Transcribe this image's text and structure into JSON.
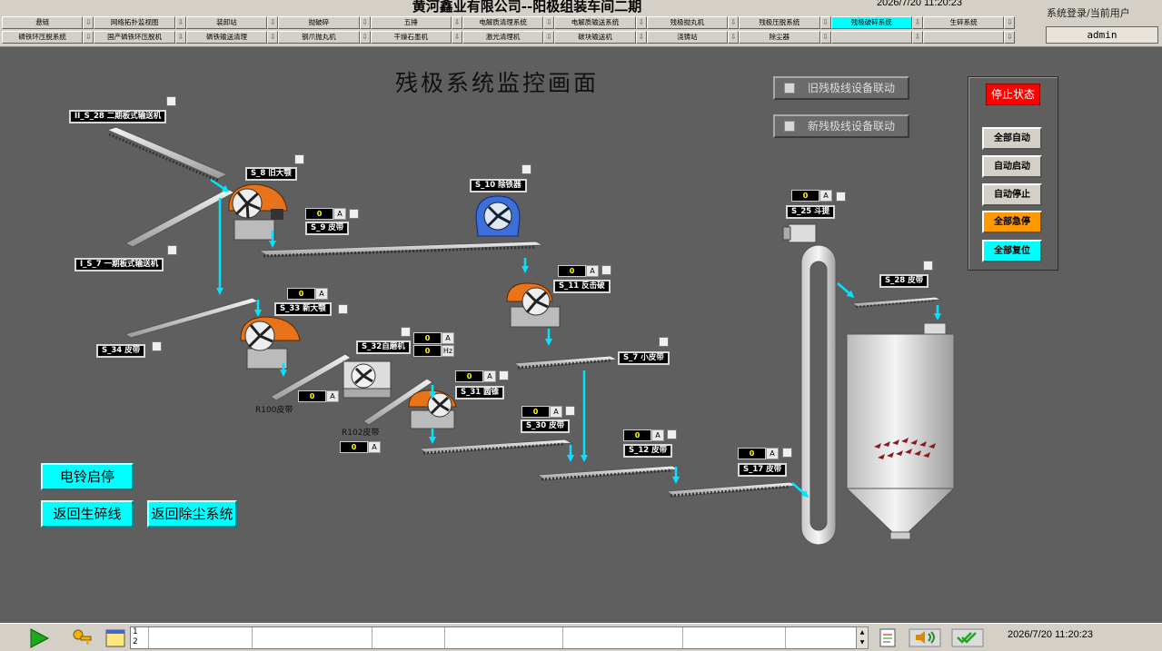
{
  "header": {
    "title": "黄河鑫业有限公司--阳极组装车间二期",
    "datetime": "2026/7/20 11:20:23",
    "login_label": "系统登录/当前用户",
    "user": "admin"
  },
  "nav": {
    "active_index": 9,
    "row1": [
      "悬链",
      "网络拓扑监视图",
      "装卸站",
      "抛破碎",
      "五捶",
      "电解质清理系统",
      "电解质输送系统",
      "残极抛丸机",
      "残极压脱系统",
      "残极破碎系统",
      "生碎系统"
    ],
    "row2": [
      "磷铁环压脱系统",
      "国产磷铁环压脱机",
      "磷铁输送清理",
      "钢爪抛丸机",
      "干燥石墨机",
      "激光清理机",
      "碳块输送机",
      "浇铸站",
      "除尘器",
      "",
      ""
    ],
    "arrow": "⇩"
  },
  "page": {
    "heading": "残极系统监控画面"
  },
  "linkage": {
    "old": "旧残极线设备联动",
    "new": "新残极线设备联动"
  },
  "control": {
    "status": "停止状态",
    "buttons": [
      "全部自动",
      "自动启动",
      "自动停止",
      "全部急停",
      "全部复位"
    ],
    "colors": {
      "status": "#ff0000",
      "estop": "#ff9900",
      "reset": "#00ffff"
    }
  },
  "equipment": {
    "s28_conveyor_ii": "II_S_28 二期板式输送机",
    "s8": "S_8 旧大颚",
    "s9": "S_9 皮带",
    "s10": "S_10 除铁器",
    "s7_conveyor_i": "I_S_7 一期板式输送机",
    "s11": "S_11 反击破",
    "s33": "S_33 新大颚",
    "s32": "S_32自磨机",
    "s34": "S_34 皮带",
    "s7_small": "S_7 小皮带",
    "s31": "S_31 圆锥",
    "s30": "S_30 皮带",
    "s12": "S_12 皮带",
    "s17": "S_17 皮带",
    "s25": "S_25 斗提",
    "s28_belt": "S_28 皮带"
  },
  "labels": {
    "r100": "R100皮带",
    "r102": "R102皮带"
  },
  "meter": {
    "value": "0",
    "unit_a": "A",
    "unit_hz": "Hz"
  },
  "buttons": {
    "bell": "电铃启停",
    "back_crush": "返回生碎线",
    "back_dust": "返回除尘系统"
  },
  "status_bar": {
    "msg_index": "1",
    "msg_index2": "2",
    "datetime": "2026/7/20 11:20:23"
  }
}
